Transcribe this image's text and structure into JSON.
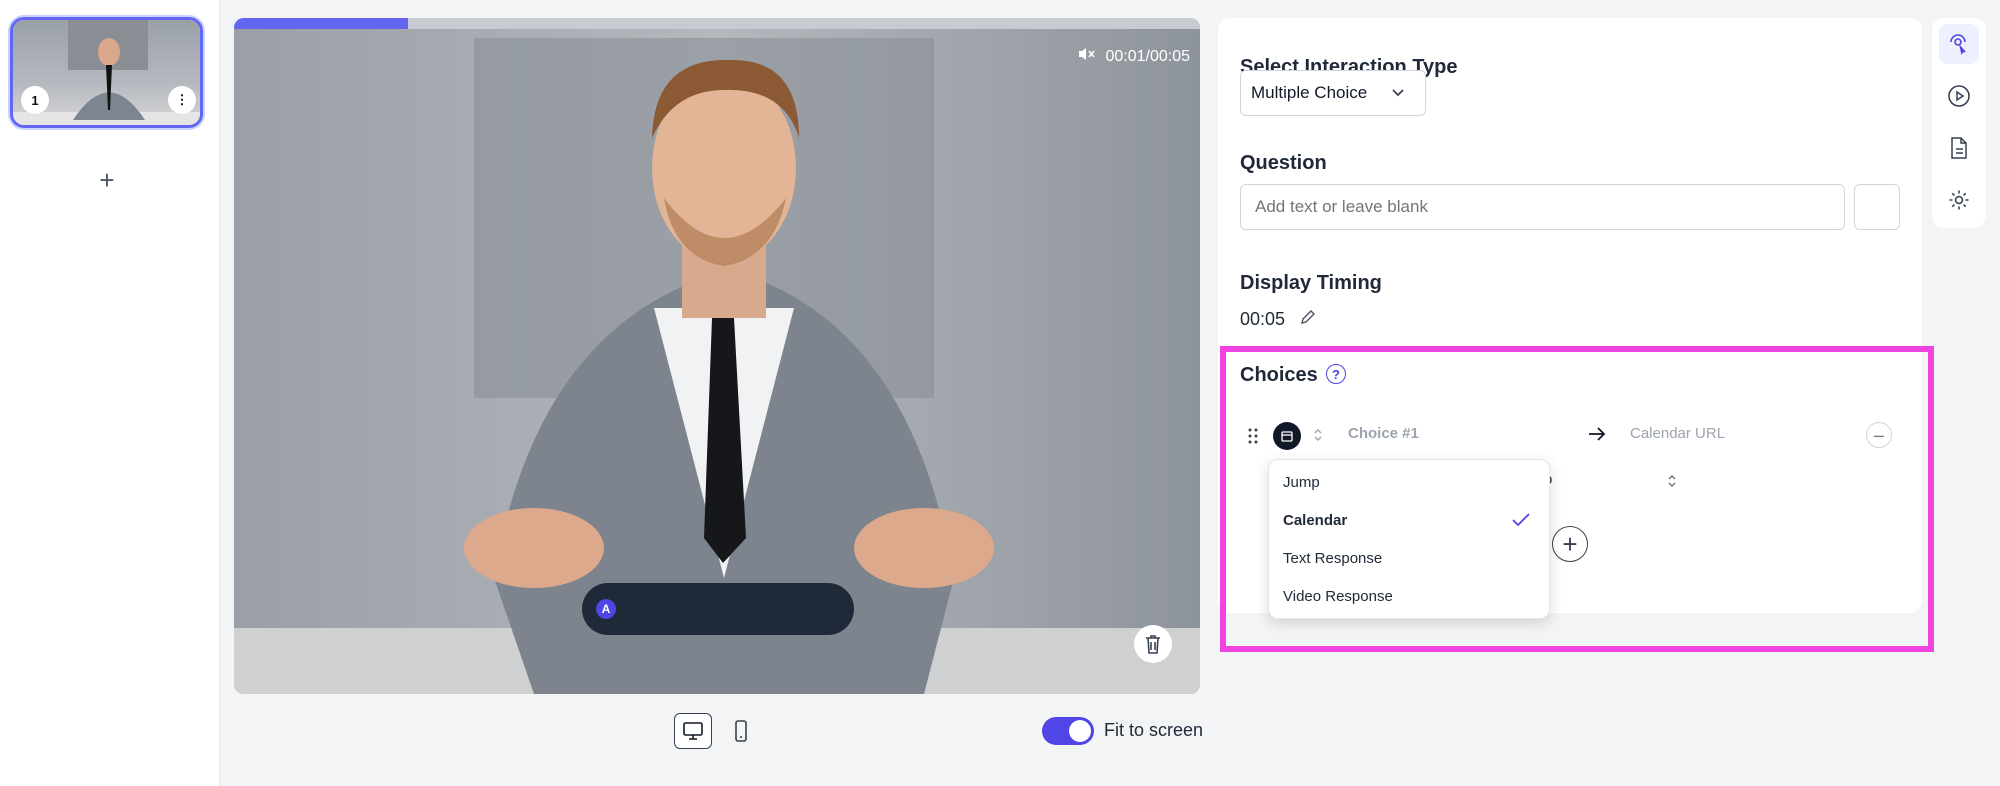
{
  "slides": {
    "items": [
      {
        "number": "1"
      }
    ],
    "add_label": "+"
  },
  "video": {
    "time": "00:01/00:05",
    "progress": 0.18,
    "caption_avatar": "A"
  },
  "bottom_bar": {
    "fit_label": "Fit to screen",
    "fit_enabled": true
  },
  "panel": {
    "interaction_type_heading": "Select Interaction Type",
    "interaction_type_value": "Multiple Choice",
    "question_heading": "Question",
    "question_placeholder": "Add text or leave blank",
    "timing_heading": "Display Timing",
    "timing_value": "00:05",
    "choices_heading": "Choices",
    "choices_help": "?",
    "choice": {
      "label": "Choice #1",
      "target_placeholder": "Calendar URL",
      "partial_text": "o"
    },
    "dropdown": {
      "options": [
        "Jump",
        "Calendar",
        "Text Response",
        "Video Response"
      ],
      "selected": "Calendar"
    }
  },
  "rail": {
    "icons": [
      "interaction-icon",
      "play-icon",
      "document-icon",
      "settings-icon"
    ]
  },
  "colors": {
    "accent": "#6366f1",
    "highlight": "#f043e0"
  }
}
